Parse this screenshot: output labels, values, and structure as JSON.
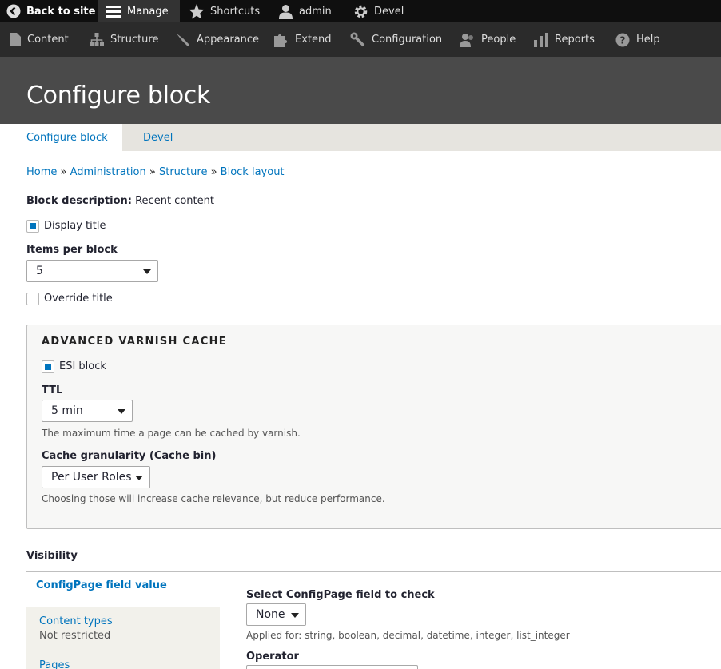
{
  "toolbar": {
    "back": "Back to site",
    "manage": "Manage",
    "shortcuts": "Shortcuts",
    "user": "admin",
    "devel": "Devel"
  },
  "menu": {
    "items": [
      "Content",
      "Structure",
      "Appearance",
      "Extend",
      "Configuration",
      "People",
      "Reports",
      "Help"
    ]
  },
  "page": {
    "title": "Configure block"
  },
  "tabs": [
    "Configure block",
    "Devel"
  ],
  "breadcrumb": [
    "Home",
    "Administration",
    "Structure",
    "Block layout"
  ],
  "block_description": {
    "label": "Block description:",
    "value": "Recent content"
  },
  "display_title": {
    "label": "Display title",
    "checked": true
  },
  "items_per_block": {
    "label": "Items per block",
    "value": "5"
  },
  "override_title": {
    "label": "Override title",
    "checked": false
  },
  "varnish": {
    "legend": "ADVANCED VARNISH CACHE",
    "esi_label": "ESI block",
    "esi_checked": true,
    "ttl_label": "TTL",
    "ttl_value": "5 min",
    "ttl_help": "The maximum time a page can be cached by varnish.",
    "granularity_label": "Cache granularity (Cache bin)",
    "granularity_value": "Per User Roles",
    "granularity_help": "Choosing those will increase cache relevance, but reduce performance."
  },
  "visibility": {
    "title": "Visibility",
    "tabs": [
      {
        "label": "ConfigPage field value",
        "sub": ""
      },
      {
        "label": "Content types",
        "sub": "Not restricted"
      },
      {
        "label": "Pages",
        "sub": ""
      }
    ],
    "field_label": "Select ConfigPage field to check",
    "field_value": "None",
    "field_help": "Applied for: string, boolean, decimal, datetime, integer, list_integer",
    "operator_label": "Operator"
  }
}
